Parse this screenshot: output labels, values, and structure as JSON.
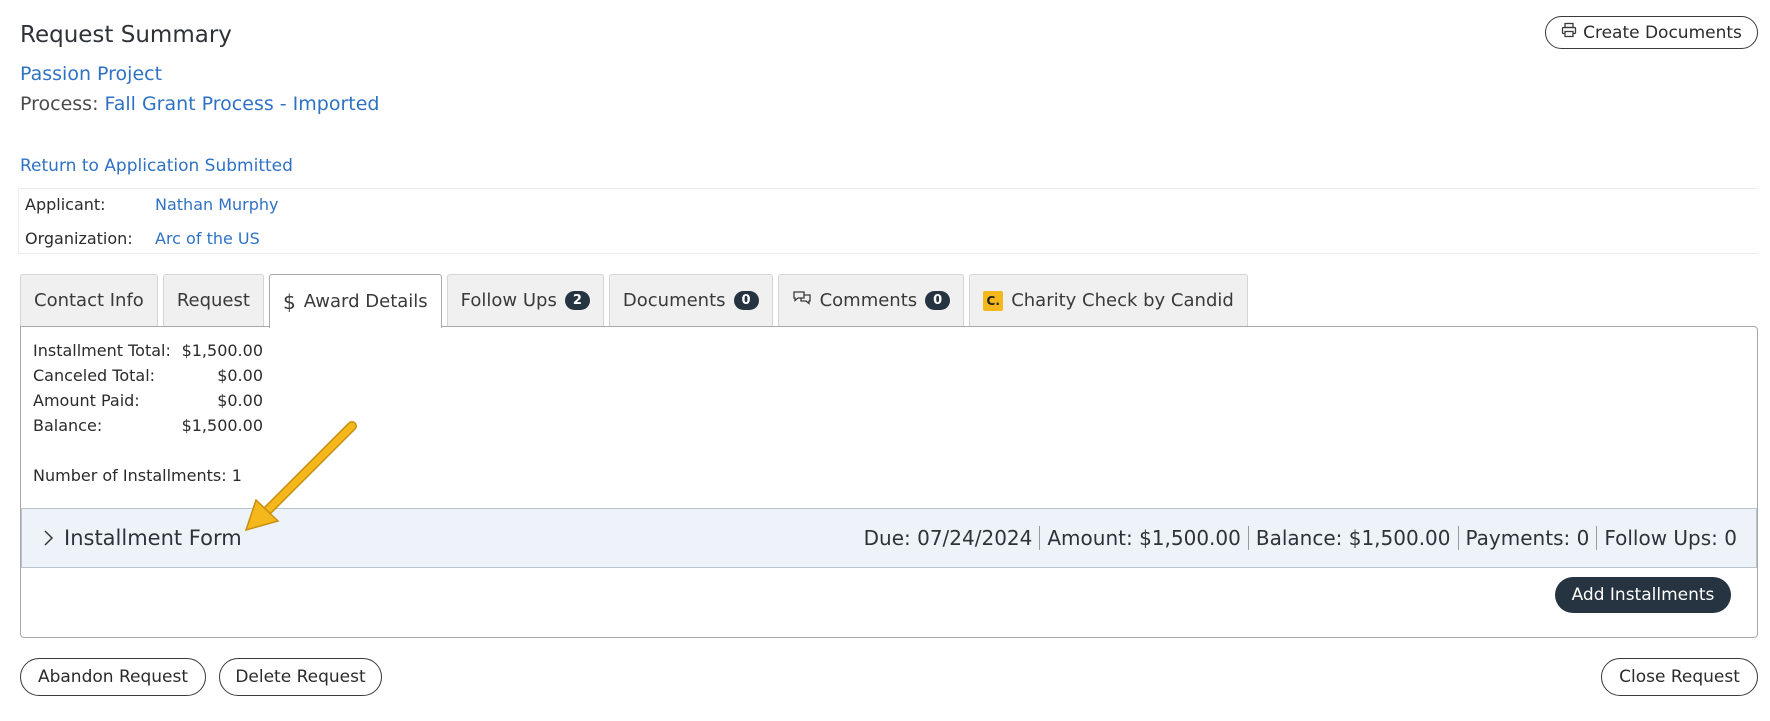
{
  "header": {
    "title": "Request Summary",
    "project_link": "Passion Project",
    "process_label": "Process:",
    "process_value": "Fall Grant Process - Imported",
    "return_link": "Return to Application Submitted",
    "create_documents_label": "Create Documents"
  },
  "people": {
    "applicant_label": "Applicant:",
    "applicant_value": "Nathan Murphy",
    "organization_label": "Organization:",
    "organization_value": "Arc of the US"
  },
  "tabs": [
    {
      "label": "Contact Info"
    },
    {
      "label": "Request"
    },
    {
      "label": "Award Details",
      "icon": "dollar-icon",
      "active": true
    },
    {
      "label": "Follow Ups",
      "badge": "2"
    },
    {
      "label": "Documents",
      "badge": "0"
    },
    {
      "label": "Comments",
      "badge": "0",
      "icon": "comments-icon"
    },
    {
      "label": "Charity Check by Candid",
      "icon": "candid-logo",
      "logo_text": "C."
    }
  ],
  "award": {
    "summary": [
      {
        "label": "Installment Total:",
        "value": "$1,500.00"
      },
      {
        "label": "Canceled Total:",
        "value": "$0.00"
      },
      {
        "label": "Amount Paid:",
        "value": "$0.00"
      },
      {
        "label": "Balance:",
        "value": "$1,500.00"
      }
    ],
    "num_installments": "Number of Installments: 1",
    "installment": {
      "title": "Installment Form",
      "due": "Due: 07/24/2024",
      "amount": "Amount: $1,500.00",
      "balance": "Balance: $1,500.00",
      "payments": "Payments: 0",
      "follow_ups": "Follow Ups: 0"
    },
    "add_installments_label": "Add Installments"
  },
  "footer": {
    "abandon_label": "Abandon Request",
    "delete_label": "Delete Request",
    "close_label": "Close Request"
  },
  "colors": {
    "link": "#2f72c4",
    "dark_button": "#263340",
    "installment_bg": "#edf3f9",
    "annotation_arrow": "#f4b81c"
  }
}
